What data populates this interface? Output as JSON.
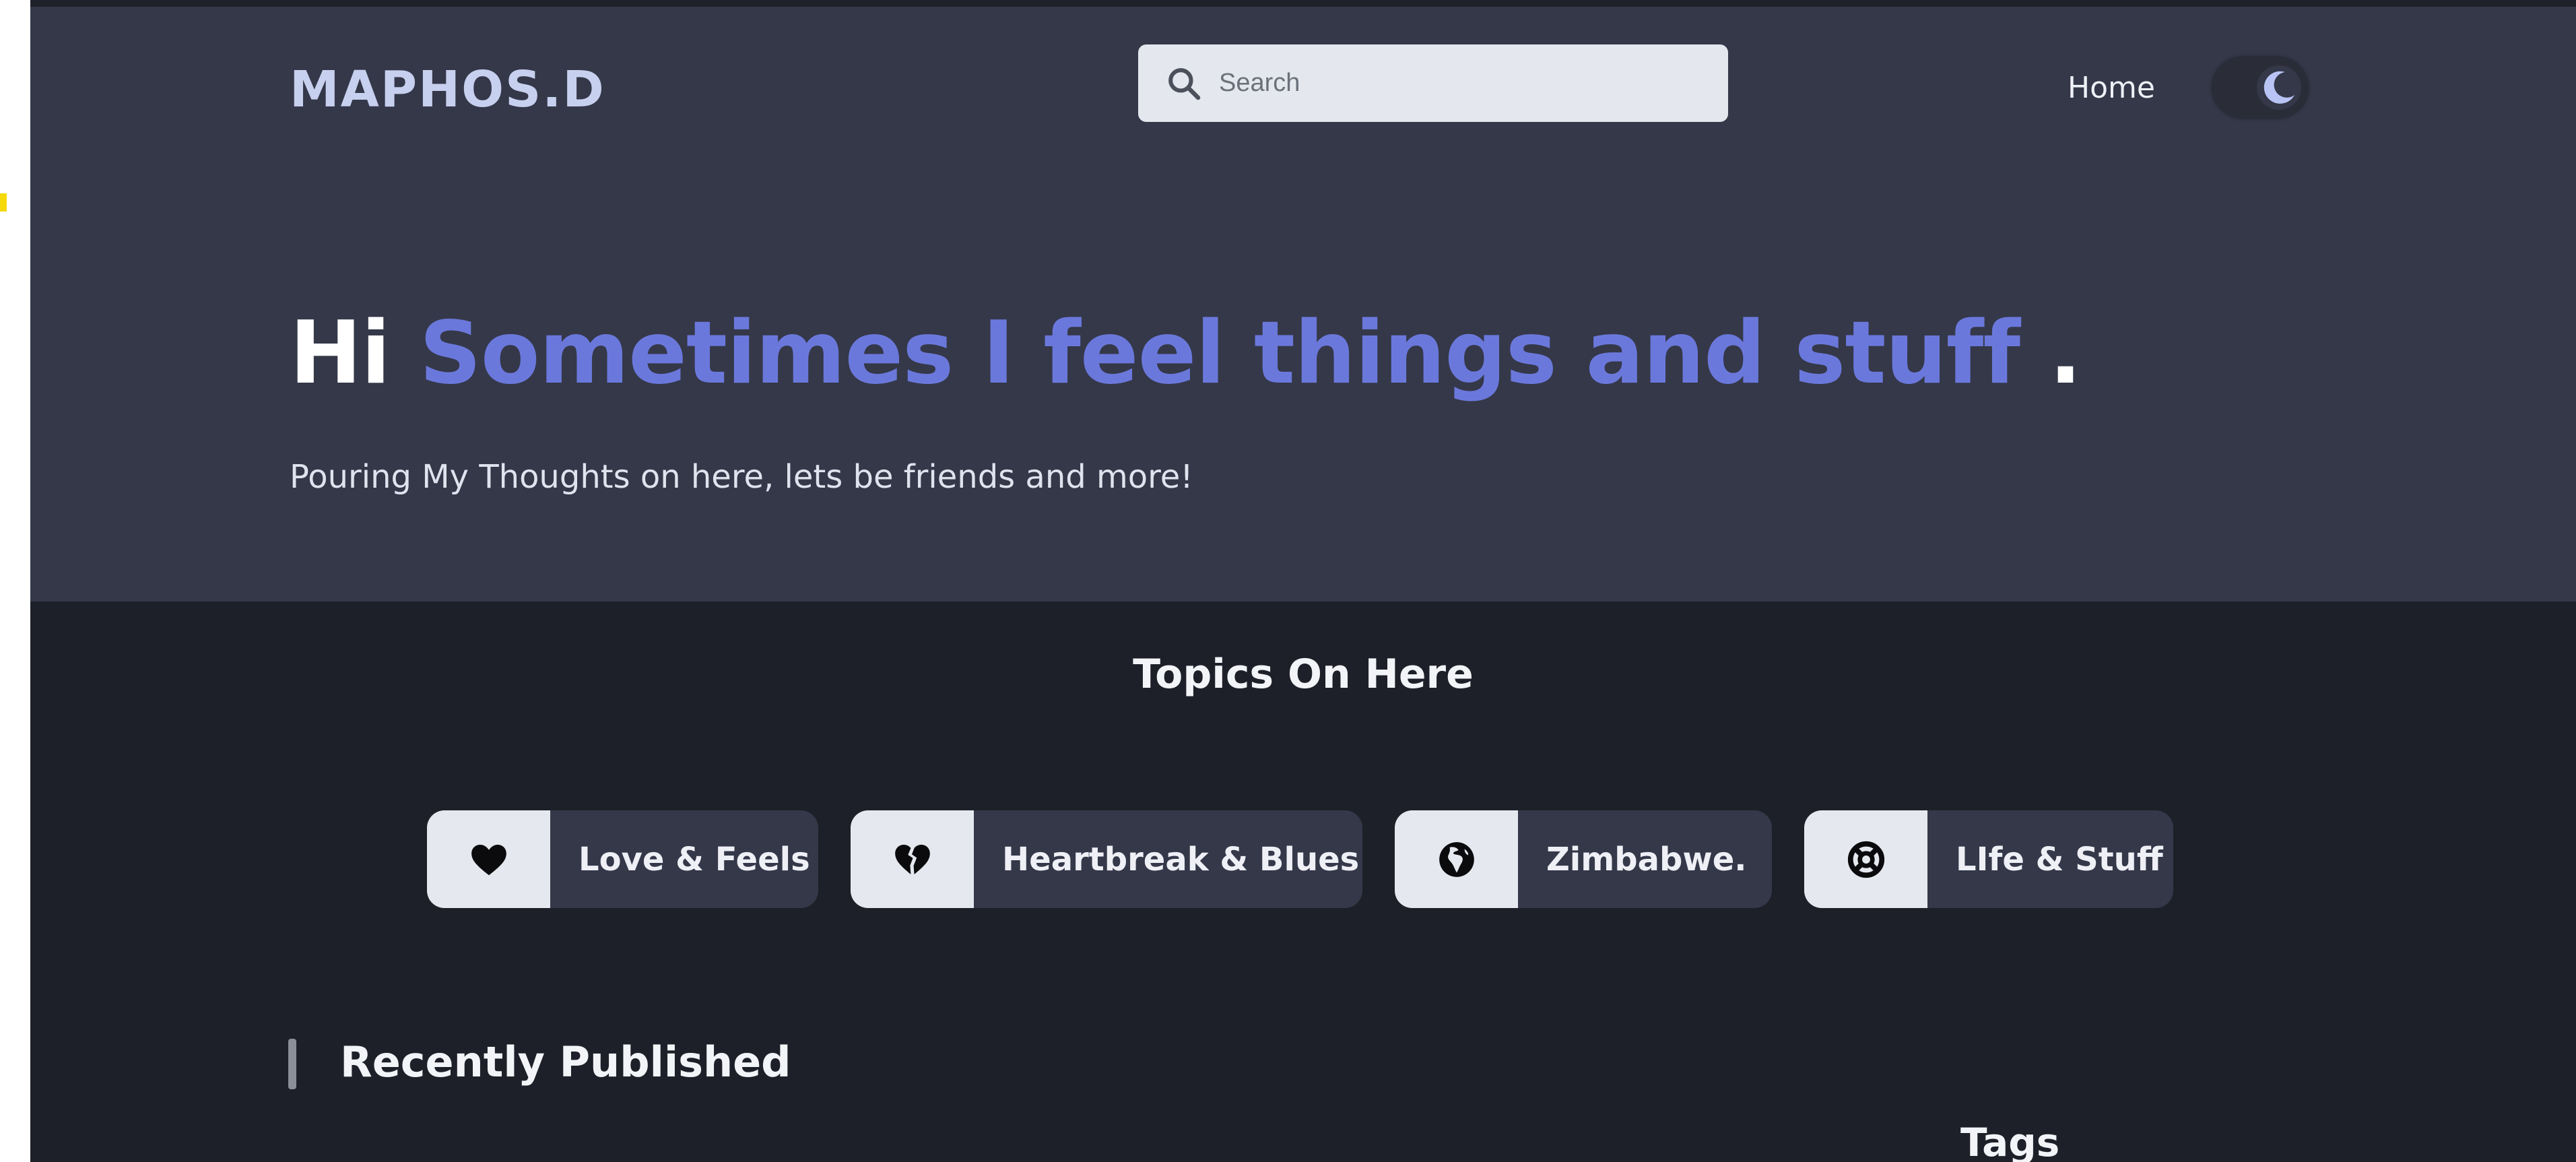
{
  "header": {
    "logo": "MAPHOS.D",
    "search": {
      "placeholder": "Search",
      "icon": "search-icon"
    },
    "nav": {
      "home": "Home"
    },
    "theme_toggle": {
      "icon": "moon-icon",
      "state": "dark"
    }
  },
  "hero": {
    "greeting": "Hi",
    "headline_accent": "Sometimes I feel things and stuff",
    "headline_end": ".",
    "subtitle": "Pouring My Thoughts on here, lets be friends and more!"
  },
  "topics": {
    "title": "Topics On Here",
    "items": [
      {
        "label": "Love & Feels",
        "icon": "heart-icon"
      },
      {
        "label": "Heartbreak & Blues",
        "icon": "broken-heart-icon"
      },
      {
        "label": "Zimbabwe.",
        "icon": "globe-africa-icon"
      },
      {
        "label": "LIfe & Stuff",
        "icon": "life-ring-icon"
      }
    ]
  },
  "recent": {
    "title": "Recently Published"
  },
  "sidebar": {
    "tags_title": "Tags"
  },
  "colors": {
    "hero_bg": "#343849",
    "page_bg": "#1e2029",
    "accent": "#6b78db",
    "chip_icon_bg": "#e5e9ef"
  }
}
